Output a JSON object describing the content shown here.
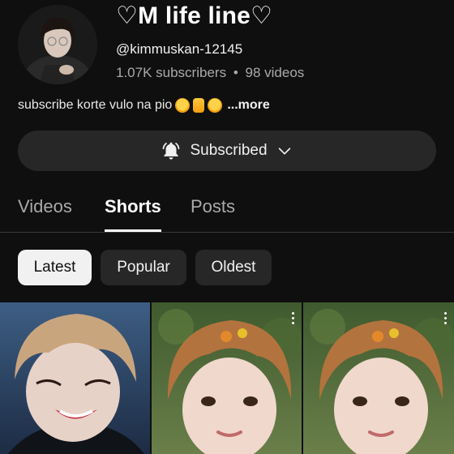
{
  "channel": {
    "title": "♡M life line♡",
    "handle": "@kimmuskan-12145",
    "subscribers": "1.07K subscribers",
    "separator": "•",
    "video_count": "98 videos",
    "description": "subscribe korte vulo na pio",
    "description_emojis": [
      "hugging-face-emoji",
      "thumbs-up-emoji",
      "pleading-face-emoji"
    ],
    "more_label": "...more"
  },
  "subscribe": {
    "label": "Subscribed",
    "icon": "bell-icon",
    "dropdown_icon": "chevron-down-icon"
  },
  "tabs": [
    {
      "label": "Videos",
      "active": false
    },
    {
      "label": "Shorts",
      "active": true
    },
    {
      "label": "Posts",
      "active": false
    }
  ],
  "filters": [
    {
      "label": "Latest",
      "selected": true
    },
    {
      "label": "Popular",
      "selected": false
    },
    {
      "label": "Oldest",
      "selected": false
    }
  ],
  "shorts": [
    {
      "name": "short-thumbnail-1",
      "has_menu": false
    },
    {
      "name": "short-thumbnail-2",
      "has_menu": true
    },
    {
      "name": "short-thumbnail-3",
      "has_menu": true
    }
  ],
  "colors": {
    "background": "#0f0f0f",
    "button": "#272727",
    "chip_selected": "#f1f1f1",
    "muted_text": "#aaaaaa"
  }
}
